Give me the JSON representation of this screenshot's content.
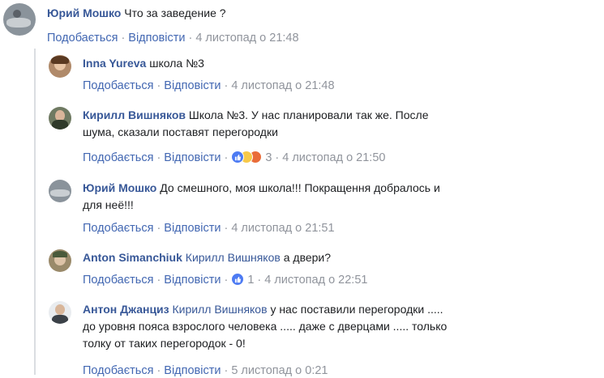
{
  "actions": {
    "like": "Подобається",
    "reply": "Відповісти"
  },
  "comments": [
    {
      "author": "Юрий Мошко",
      "text": "Что за заведение ?",
      "time": "4 листопад о 21:48"
    },
    {
      "author": "Inna Yureva",
      "text": "школа №3",
      "time": "4 листопад о 21:48"
    },
    {
      "author": "Кирилл Вишняков",
      "text_line1": "Школа №3. У нас планировали так же. После",
      "text_line2": "шума, сказали поставят перегородки",
      "time": "4 листопад о 21:50",
      "reactions_count": "3",
      "reactions": [
        "like-icon",
        "haha-icon",
        "angry-icon"
      ]
    },
    {
      "author": "Юрий Мошко",
      "text_line1": "До смешного, моя школа!!! Покращення добралось и",
      "text_line2": "для неё!!!",
      "time": "4 листопад о 21:51"
    },
    {
      "author": "Anton Simanchiuk",
      "mention": "Кирилл Вишняков",
      "text": "а двери?",
      "time": "4 листопад о 22:51",
      "reactions_count": "1",
      "reactions": [
        "like-icon"
      ]
    },
    {
      "author": "Антон Джанциз",
      "mention": "Кирилл Вишняков",
      "text_line1": "у нас поставили перегородки .....",
      "text_line2": "до уровня пояса взрослого человека ..... даже с дверцами ..... только",
      "text_line3": "толку от таких перегородок - 0!",
      "time": "5 листопад о 0:21"
    }
  ],
  "colors": {
    "link": "#385898",
    "action": "#4267b2",
    "meta": "#90949c",
    "like": "#4d7bf3"
  }
}
